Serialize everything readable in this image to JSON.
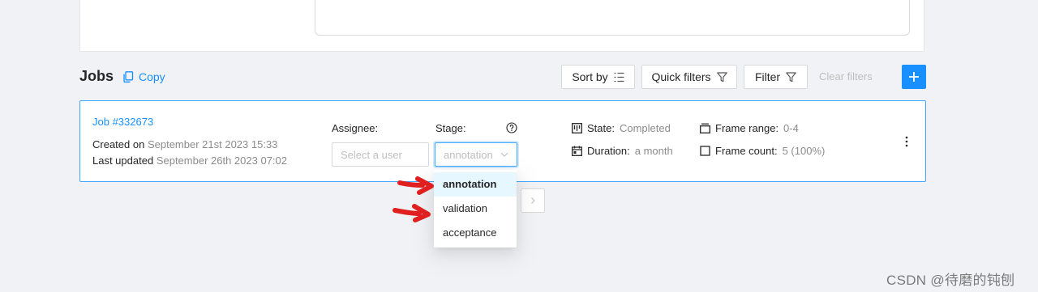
{
  "jobs_header": {
    "title": "Jobs",
    "copy_label": "Copy"
  },
  "toolbar": {
    "sort_by": "Sort by",
    "quick_filters": "Quick filters",
    "filter": "Filter",
    "clear_filters": "Clear filters"
  },
  "job": {
    "id_label": "Job #332673",
    "created_prefix": "Created on",
    "created_value": "September 21st 2023 15:33",
    "updated_prefix": "Last updated",
    "updated_value": "September 26th 2023 07:02",
    "assignee_label": "Assignee:",
    "assignee_placeholder": "Select a user",
    "stage_label": "Stage:",
    "stage_value": "annotation",
    "state_label": "State:",
    "state_value": "Completed",
    "duration_label": "Duration:",
    "duration_value": "a month",
    "frame_range_label": "Frame range:",
    "frame_range_value": "0-4",
    "frame_count_label": "Frame count:",
    "frame_count_value": "5 (100%)"
  },
  "stage_dropdown": {
    "options": [
      "annotation",
      "validation",
      "acceptance"
    ],
    "active_index": 0
  },
  "watermark": "CSDN @待磨的钝刨",
  "colors": {
    "accent": "#1890ff",
    "annotation_arrow": "#e02020",
    "background": "#f0f2f5"
  }
}
